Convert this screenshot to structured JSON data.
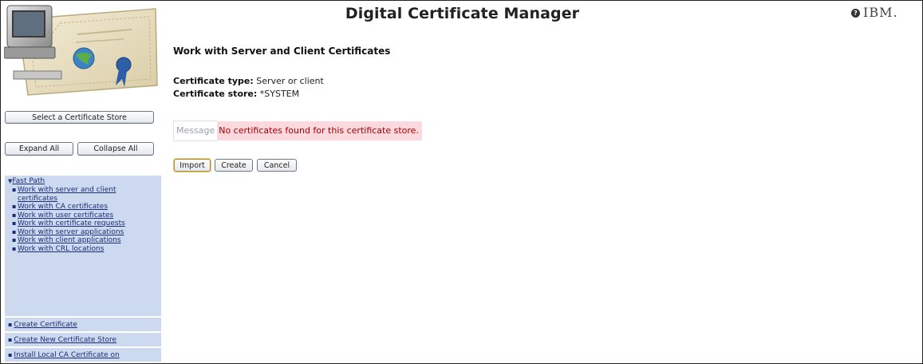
{
  "header": {
    "title": "Digital Certificate Manager",
    "help_icon": "question-circle-icon",
    "help_glyph": "?",
    "brand": "IBM."
  },
  "sidebar": {
    "logo_icon": "certificate-computer-icon",
    "select_store_label": "Select a Certificate Store",
    "expand_label": "Expand All",
    "collapse_label": "Collapse All",
    "fast_path": {
      "heading": "Fast Path",
      "items": [
        "Work with server and client certificates",
        "Work with CA certificates",
        "Work with user certificates",
        "Work with certificate requests",
        "Work with server applications",
        "Work with client applications",
        "Work with CRL locations"
      ]
    },
    "links": [
      "Create Certificate",
      "Create New Certificate Store",
      "Install Local CA Certificate on"
    ]
  },
  "main": {
    "title": "Work with Server and Client Certificates",
    "cert_type_label": "Certificate type:",
    "cert_type_value": "Server or client",
    "cert_store_label": "Certificate store:",
    "cert_store_value": "*SYSTEM",
    "message_label": "Message",
    "message_text": "No certificates found for this certificate store.",
    "buttons": {
      "import": "Import",
      "create": "Create",
      "cancel": "Cancel"
    }
  },
  "colors": {
    "nav_bg": "#ccd9ee",
    "link": "#1b2d7a",
    "message_bg": "#fbd9df",
    "message_text": "#aa0000"
  }
}
